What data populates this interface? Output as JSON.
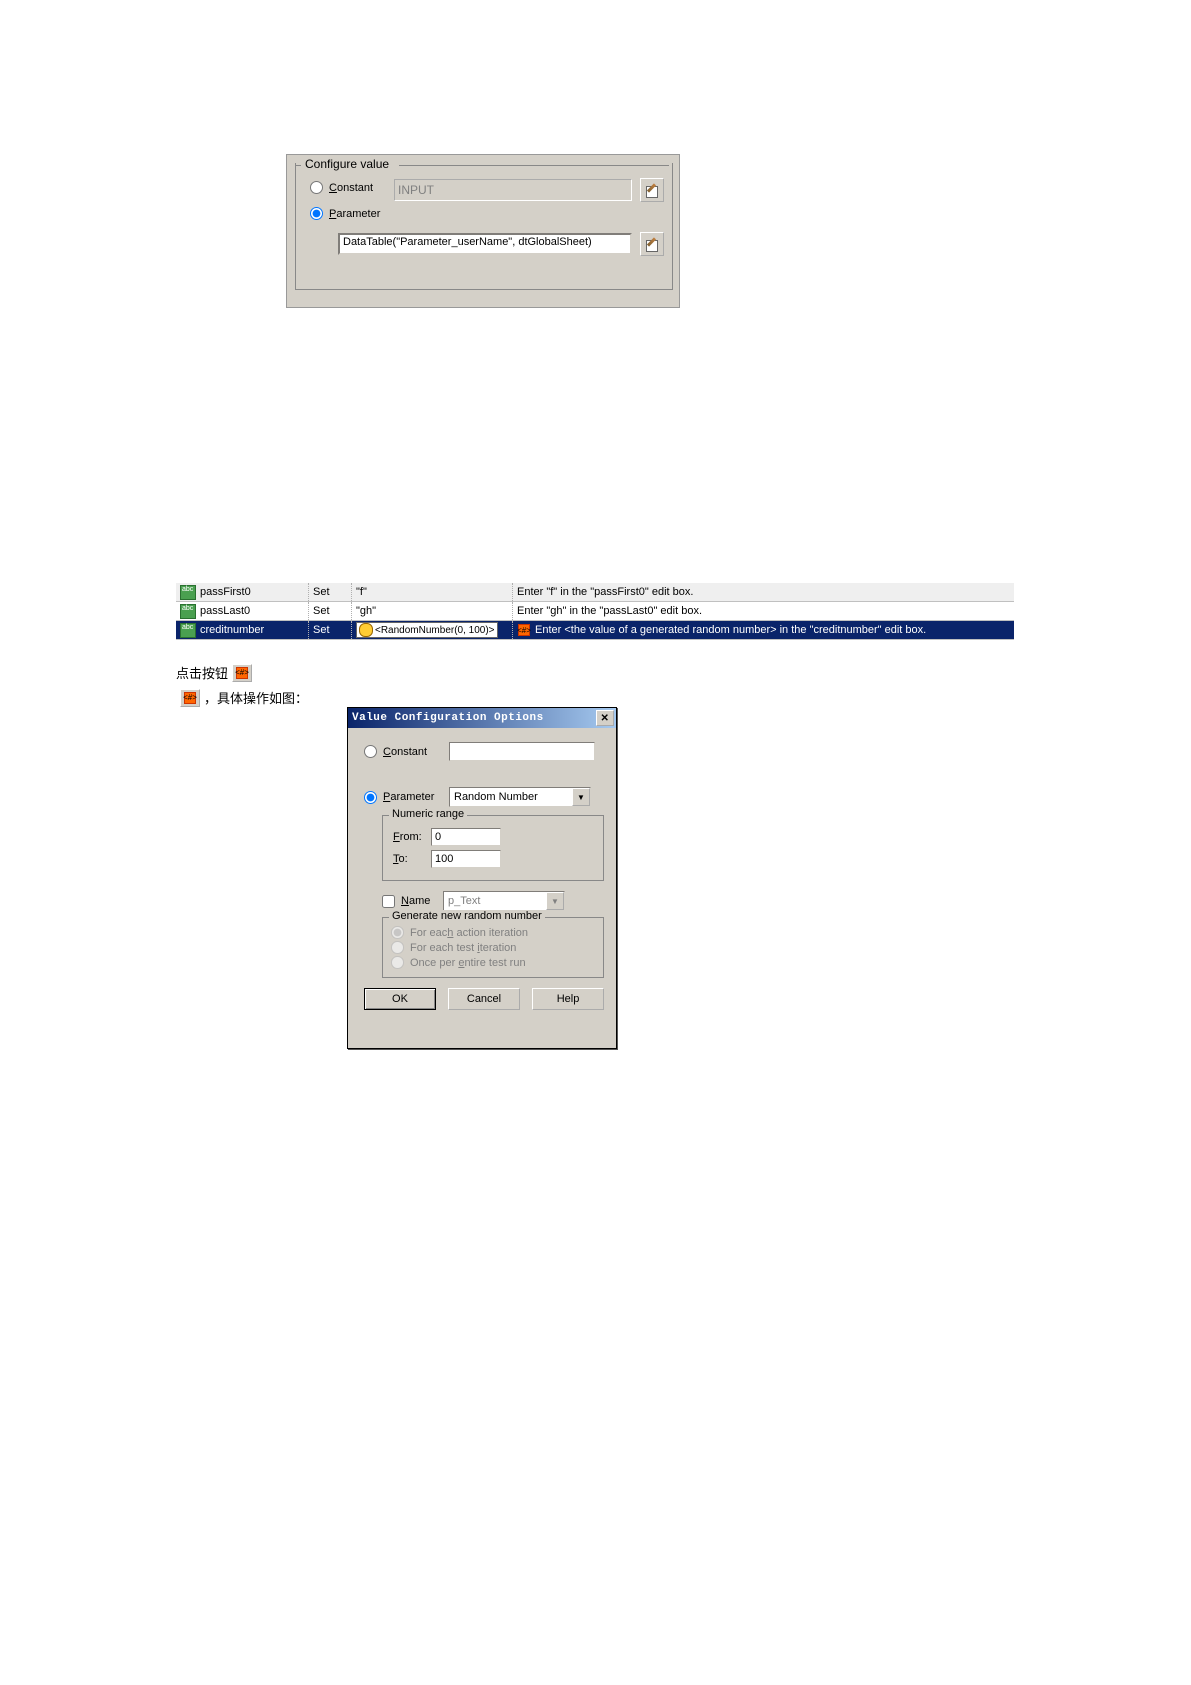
{
  "configure": {
    "legend": "Configure value",
    "constant_label": "Constant",
    "constant_value": "INPUT",
    "parameter_label": "Parameter",
    "parameter_value": "DataTable(\"Parameter_userName\", dtGlobalSheet)"
  },
  "grid": {
    "rows": [
      {
        "item": "passFirst0",
        "op": "Set",
        "value": "\"f\"",
        "doc": "Enter \"f\" in the \"passFirst0\" edit box."
      },
      {
        "item": "passLast0",
        "op": "Set",
        "value": "\"gh\"",
        "doc": "Enter \"gh\" in the \"passLast0\" edit box."
      },
      {
        "item": "creditnumber",
        "op": "Set",
        "value": "<RandomNumber(0, 100)>",
        "doc": "Enter <the value of a generated random number> in the \"creditnumber\" edit box."
      }
    ]
  },
  "line_click_prefix": "点击按钮 ",
  "line_click_suffix": "",
  "line_detail_prefix": "",
  "line_detail_suffix": "，具体操作如图：",
  "dialog": {
    "title": "Value Configuration Options",
    "constant_label": "Constant",
    "parameter_label": "Parameter",
    "parameter_value": "Random Number",
    "numeric_range_legend": "Numeric range",
    "from_label": "From:",
    "from_value": "0",
    "to_label": "To:",
    "to_value": "100",
    "name_label": "Name",
    "name_value": "p_Text",
    "generate_legend": "Generate new random number",
    "gen_opt1": "For each action iteration",
    "gen_opt2": "For each test iteration",
    "gen_opt3": "Once per entire test run",
    "ok": "OK",
    "cancel": "Cancel",
    "help": "Help"
  }
}
